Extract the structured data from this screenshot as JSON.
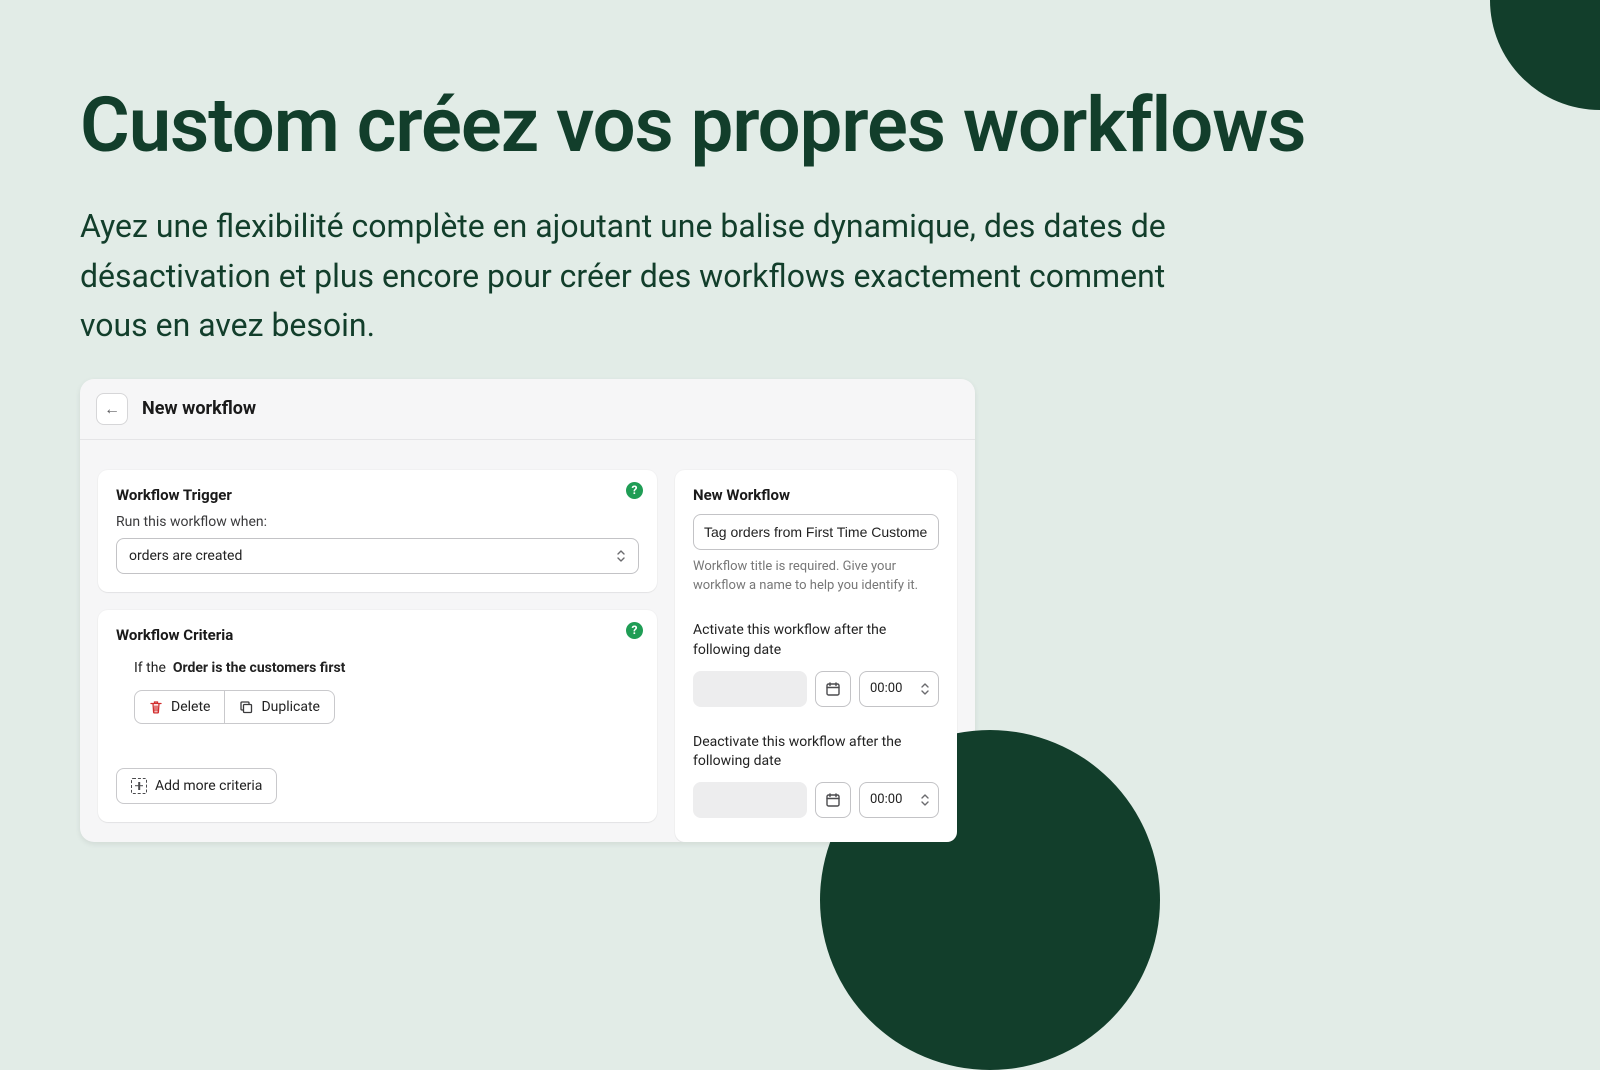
{
  "hero": {
    "title": "Custom créez vos propres workflows",
    "subtitle": "Ayez une flexibilité complète en ajoutant une balise dynamique, des dates de désactivation et plus encore pour créer des workflows exactement comment vous en avez besoin."
  },
  "header": {
    "title": "New workflow"
  },
  "trigger": {
    "title": "Workflow Trigger",
    "run_label": "Run this workflow when:",
    "select_value": "orders are created"
  },
  "criteria": {
    "title": "Workflow Criteria",
    "if_prefix": "If the",
    "if_condition": "Order is the customers first",
    "delete_label": "Delete",
    "duplicate_label": "Duplicate",
    "add_label": "Add more criteria"
  },
  "sidebar": {
    "title": "New Workflow",
    "name_value": "Tag orders from First Time Customers",
    "helper": "Workflow title is required. Give your workflow a name to help you identify it.",
    "activate_label": "Activate this workflow after the following date",
    "activate_time": "00:00",
    "deactivate_label": "Deactivate this workflow after the following date",
    "deactivate_time": "00:00"
  }
}
